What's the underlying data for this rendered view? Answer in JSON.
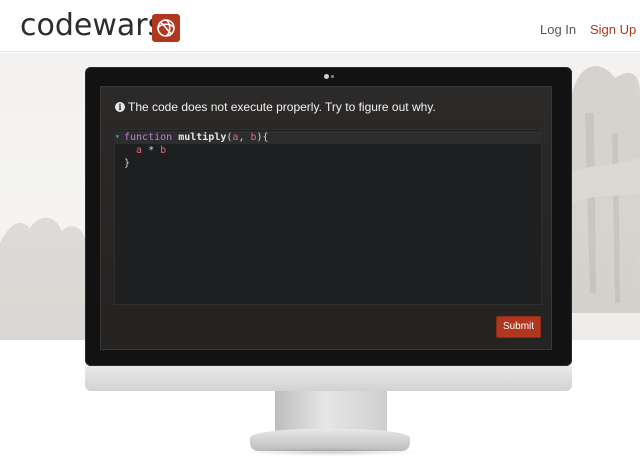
{
  "brand": {
    "name": "codewars",
    "color": "#b1361e"
  },
  "nav": {
    "login_label": "Log In",
    "signup_label": "Sign Up"
  },
  "challenge": {
    "instruction": "The code does not execute properly. Try to figure out why.",
    "info_icon": "info-icon",
    "code": {
      "language": "javascript",
      "lines": [
        {
          "kw": "function",
          "fn": "multiply",
          "open": "(",
          "p1": "a",
          "comma": ", ",
          "p2": "b",
          "close": "){"
        },
        {
          "indent": "  ",
          "a": "a",
          "op": " * ",
          "b": "b"
        },
        {
          "text": "}"
        }
      ]
    },
    "submit_label": "Submit"
  }
}
